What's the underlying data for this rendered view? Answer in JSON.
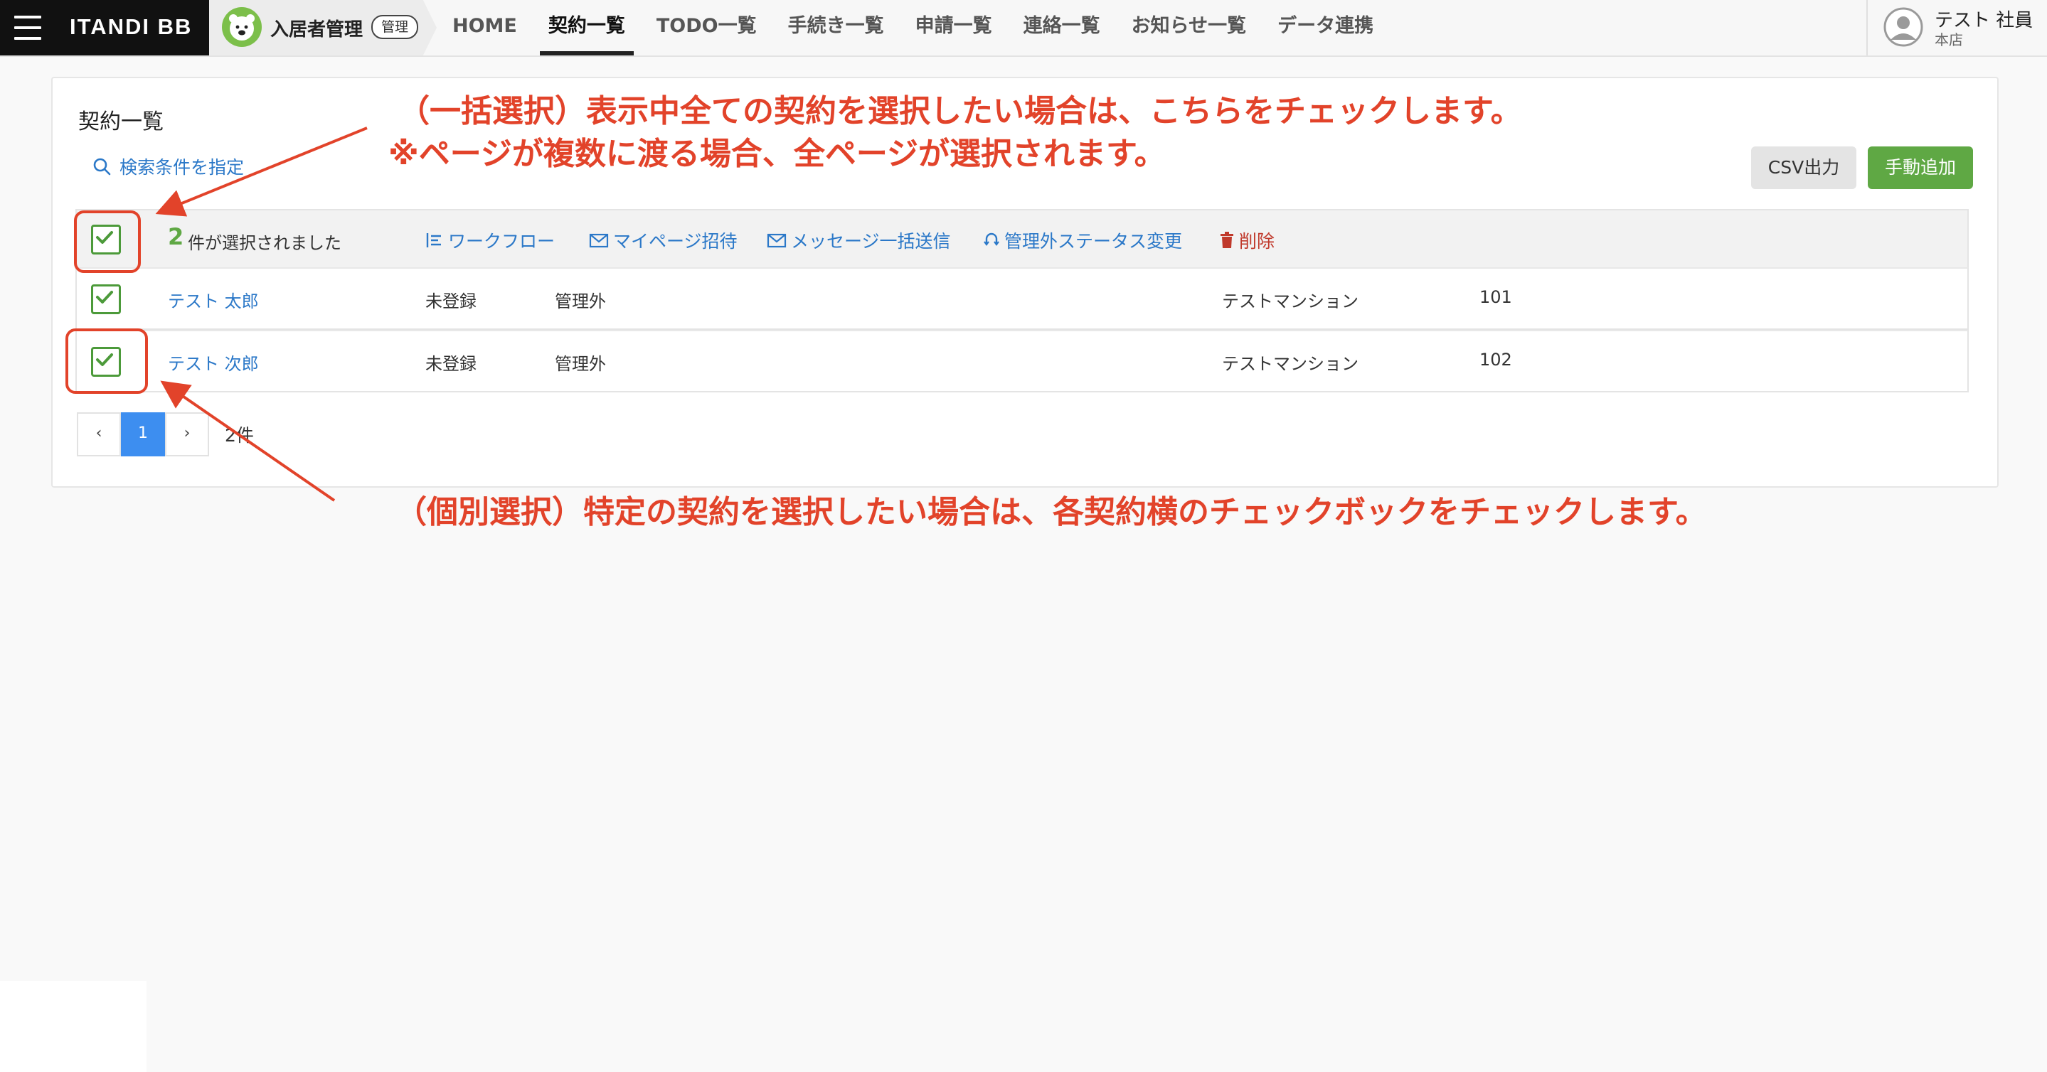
{
  "brand": {
    "name": "ITANDI BB"
  },
  "app": {
    "name": "入居者管理",
    "badge": "管理"
  },
  "nav": {
    "items": [
      {
        "label": "HOME"
      },
      {
        "label": "契約一覧",
        "active": true
      },
      {
        "label": "TODO一覧"
      },
      {
        "label": "手続き一覧"
      },
      {
        "label": "申請一覧"
      },
      {
        "label": "連絡一覧"
      },
      {
        "label": "お知らせ一覧"
      },
      {
        "label": "データ連携"
      }
    ]
  },
  "user": {
    "name": "テスト 社員",
    "store": "本店"
  },
  "page": {
    "title": "契約一覧",
    "search_label": "検索条件を指定",
    "csv_button": "CSV出力",
    "add_button": "手動追加"
  },
  "selection": {
    "count": "2",
    "text": "件が選択されました",
    "actions": {
      "workflow": "ワークフロー",
      "mypage": "マイページ招待",
      "message": "メッセージ一括送信",
      "status": "管理外ステータス変更",
      "delete": "削除"
    }
  },
  "rows": [
    {
      "name": "テスト 太郎",
      "registration": "未登録",
      "management": "管理外",
      "building": "テストマンション",
      "room": "101",
      "checked": true
    },
    {
      "name": "テスト 次郎",
      "registration": "未登録",
      "management": "管理外",
      "building": "テストマンション",
      "room": "102",
      "checked": true
    }
  ],
  "pagination": {
    "prev": "‹",
    "current": "1",
    "next": "›",
    "total": "2件"
  },
  "annotations": {
    "bulk_line1": "（一括選択）表示中全ての契約を選択したい場合は、こちらをチェックします。",
    "bulk_line2": "※ページが複数に渡る場合、全ページが選択されます。",
    "single": "（個別選択）特定の契約を選択したい場合は、各契約横のチェックボックをチェックします。"
  },
  "colors": {
    "accent_green": "#5fa844",
    "link_blue": "#2b78c8",
    "annotation_red": "#e2432a"
  }
}
